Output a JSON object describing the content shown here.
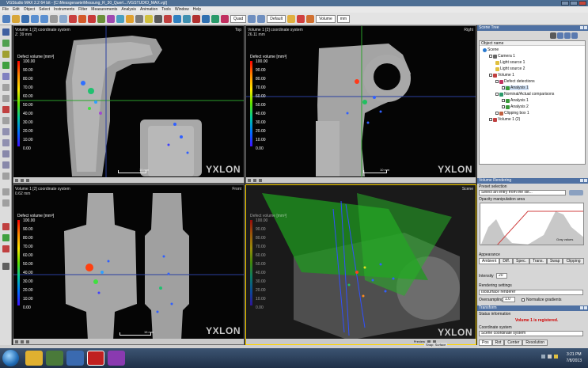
{
  "window": {
    "title": "VGStudio MAX 2.2 64 bit - [C:\\Messgeraete\\Messung_R_30_Quer\\...\\VGSTUDIO_MAX.vgl]"
  },
  "menu": [
    "File",
    "Edit",
    "Object",
    "Select",
    "Instruments",
    "Filter",
    "Measurements",
    "Analysis",
    "Animation",
    "Tools",
    "Window",
    "Help"
  ],
  "toolbar": {
    "view_layout": "Quad",
    "view_mode": "Default",
    "volume_select": "Volume",
    "zoom_select": "mm"
  },
  "viewports": [
    {
      "title": "Volume 1 [2] coordinate system",
      "sub": "Z: 39 mm",
      "corner": "Top",
      "scale": "10 mm",
      "watermark": "YXLON"
    },
    {
      "title": "Volume 1 [2] coordinate system",
      "sub": "26.11 mm",
      "corner": "Right",
      "scale": "10 mm",
      "watermark": "YXLON"
    },
    {
      "title": "Volume 1 [2] coordinate system",
      "sub": "0.62 mm",
      "corner": "Front",
      "scale": "15 mm",
      "watermark": "YXLON"
    },
    {
      "title": "",
      "sub": "",
      "corner": "Scene",
      "scale": "",
      "watermark": "YXLON",
      "footer": "Preview"
    }
  ],
  "legend": {
    "title": "Defect volume [mm³]",
    "values": [
      "100.00",
      "90.00",
      "80.00",
      "70.00",
      "60.00",
      "50.00",
      "40.00",
      "30.00",
      "20.00",
      "10.00",
      "0.00"
    ]
  },
  "scene_tree": {
    "header": "Scene Tree",
    "column": "Object name",
    "items": [
      {
        "label": "Scene",
        "depth": 0
      },
      {
        "label": "Camera 1",
        "depth": 1
      },
      {
        "label": "Light source 1",
        "depth": 2
      },
      {
        "label": "Light source 2",
        "depth": 2
      },
      {
        "label": "Volume 1",
        "depth": 1
      },
      {
        "label": "Defect detections",
        "depth": 2
      },
      {
        "label": "Analysis 1",
        "depth": 3
      },
      {
        "label": "Nominal/Actual comparisons",
        "depth": 2
      },
      {
        "label": "Analysis 1",
        "depth": 3
      },
      {
        "label": "Analysis 2",
        "depth": 3
      },
      {
        "label": "Clipping box 1",
        "depth": 2
      },
      {
        "label": "Volume 1 (2)",
        "depth": 1
      }
    ]
  },
  "volume_rendering": {
    "header": "Volume Rendering",
    "preset_label": "Preset selection",
    "preset_value": "Select an entry from the list...",
    "opacity_label": "Opacity manipulation area",
    "opacity_note": "Gray values",
    "appearance_label": "Appearance",
    "tabs": [
      "Ambient",
      "Diff.",
      "Spec.",
      "Trans.",
      "Swap",
      "Clipping"
    ],
    "intensity_label": "Intensity",
    "intensity_value": "20",
    "rendering_settings": "Rendering settings",
    "renderer": "Isosurface renderer",
    "oversampling_label": "Oversampling",
    "oversampling_value": "1.0",
    "normalize_label": "Normalize gradients"
  },
  "transform": {
    "header": "Transform",
    "status_label": "Status information",
    "status_value": "Volume 1 is registered.",
    "coord_label": "Coordinate system",
    "coord_value": "Scene coordinate system",
    "tabs": [
      "Pos",
      "Rot",
      "Center",
      "Resolution"
    ]
  },
  "status": {
    "snap": "Snap: Surface"
  },
  "taskbar": {
    "time": "3:21 PM",
    "date": "7/8/2013"
  }
}
